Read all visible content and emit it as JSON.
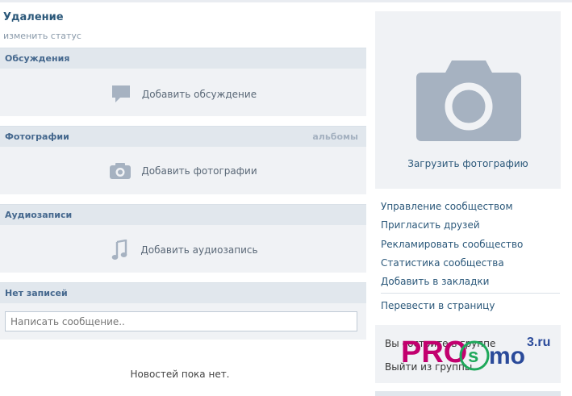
{
  "group": {
    "title": "Удаление",
    "status_link": "изменить статус"
  },
  "sections": {
    "discussions": {
      "label": "Обсуждения",
      "add_label": "Добавить обсуждение",
      "icon": "speech-bubble-icon"
    },
    "photos": {
      "label": "Фотографии",
      "side_link": "альбомы",
      "add_label": "Добавить фотографии",
      "icon": "camera-icon"
    },
    "audio": {
      "label": "Аудиозаписи",
      "add_label": "Добавить аудиозапись",
      "icon": "music-note-icon"
    },
    "wall": {
      "label": "Нет записей",
      "placeholder": "Написать сообщение..",
      "empty_text": "Новостей пока нет."
    }
  },
  "sidebar": {
    "upload_photo": "Загрузить фотографию",
    "actions": [
      "Управление сообществом",
      "Пригласить друзей",
      "Рекламировать сообщество",
      "Статистика сообщества",
      "Добавить в закладки"
    ],
    "convert": "Перевести в страницу",
    "member_status": "Вы состоите в группе",
    "leave": "Выйти из группы"
  },
  "watermark": {
    "brand": "PRO",
    "brand_o_letter": "s",
    "brand_mo": "mo",
    "tld": "3.ru"
  },
  "colors": {
    "link": "#2b587a",
    "header_bg": "#e1e7ed",
    "block_bg": "#f0f2f5",
    "icon_gray": "#a6b2c1",
    "watermark_magenta": "#c2006e",
    "watermark_green": "#1ea85a",
    "watermark_blue": "#2a4a9a"
  }
}
